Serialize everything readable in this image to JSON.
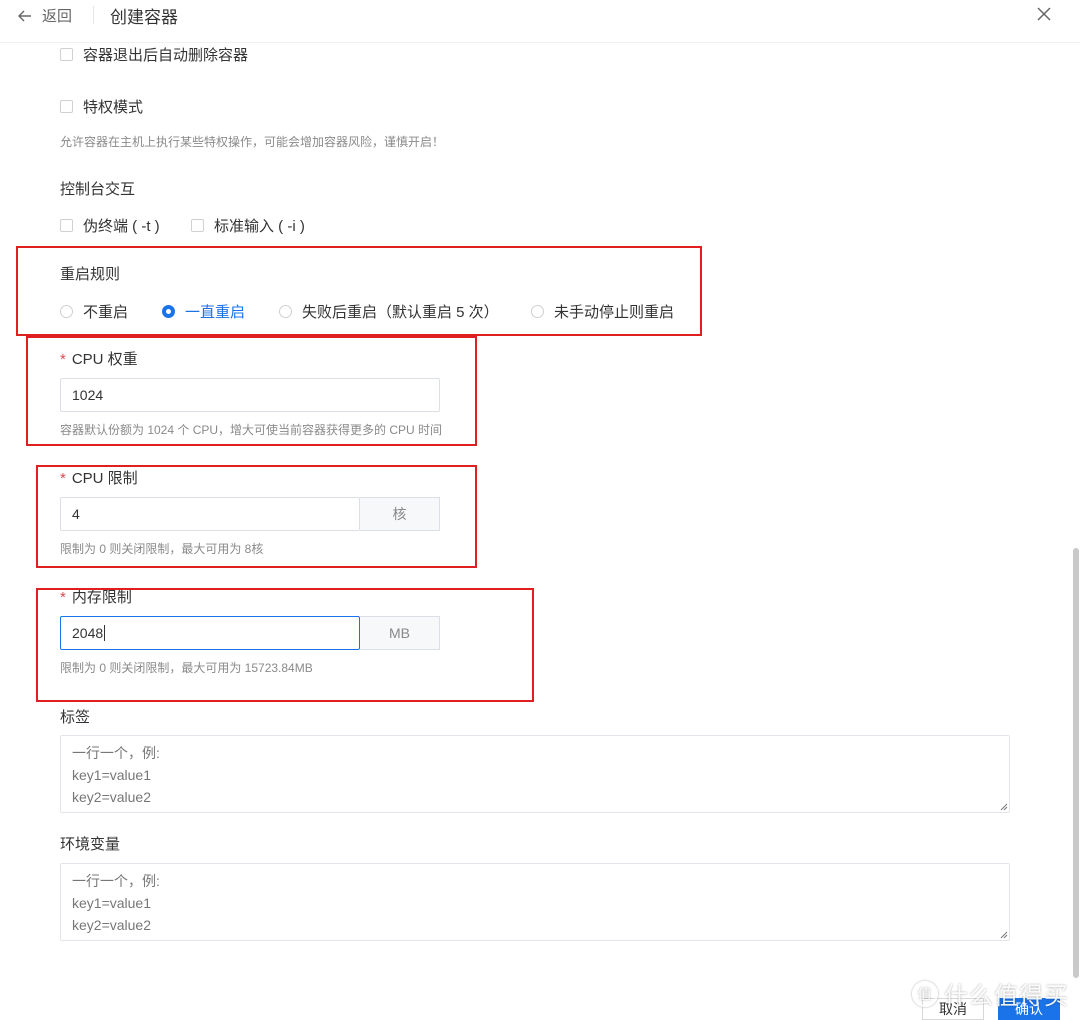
{
  "header": {
    "back_label": "返回",
    "title": "创建容器"
  },
  "options": {
    "auto_remove_label": "容器退出后自动删除容器",
    "privileged_label": "特权模式",
    "privileged_hint": "允许容器在主机上执行某些特权操作，可能会增加容器风险，谨慎开启！"
  },
  "console": {
    "label": "控制台交互",
    "tty_label": "伪终端 ( -t )",
    "stdin_label": "标准输入 ( -i )"
  },
  "restart": {
    "label": "重启规则",
    "options": [
      "不重启",
      "一直重启",
      "失败后重启（默认重启 5 次）",
      "未手动停止则重启"
    ],
    "selected": "一直重启"
  },
  "cpu_weight": {
    "required_mark": "*",
    "label": "CPU 权重",
    "value": "1024",
    "hint": "容器默认份额为 1024 个 CPU，增大可使当前容器获得更多的 CPU 时间"
  },
  "cpu_limit": {
    "required_mark": "*",
    "label": "CPU 限制",
    "value": "4",
    "unit": "核",
    "hint": "限制为 0 则关闭限制，最大可用为 8核"
  },
  "mem_limit": {
    "required_mark": "*",
    "label": "内存限制",
    "value": "2048",
    "unit": "MB",
    "hint": "限制为 0 则关闭限制，最大可用为 15723.84MB"
  },
  "labels": {
    "label": "标签",
    "placeholder_lines": [
      "一行一个，例:",
      "key1=value1",
      "key2=value2"
    ]
  },
  "env": {
    "label": "环境变量",
    "placeholder_lines": [
      "一行一个，例:",
      "key1=value1",
      "key2=value2"
    ]
  },
  "footer": {
    "cancel_label": "取消",
    "ok_label": "确认"
  },
  "watermark": {
    "logo": "值",
    "text": "什么值得买"
  },
  "colors": {
    "accent": "#1a73e8",
    "annotation_red": "#e02020",
    "required": "#e5484d"
  }
}
